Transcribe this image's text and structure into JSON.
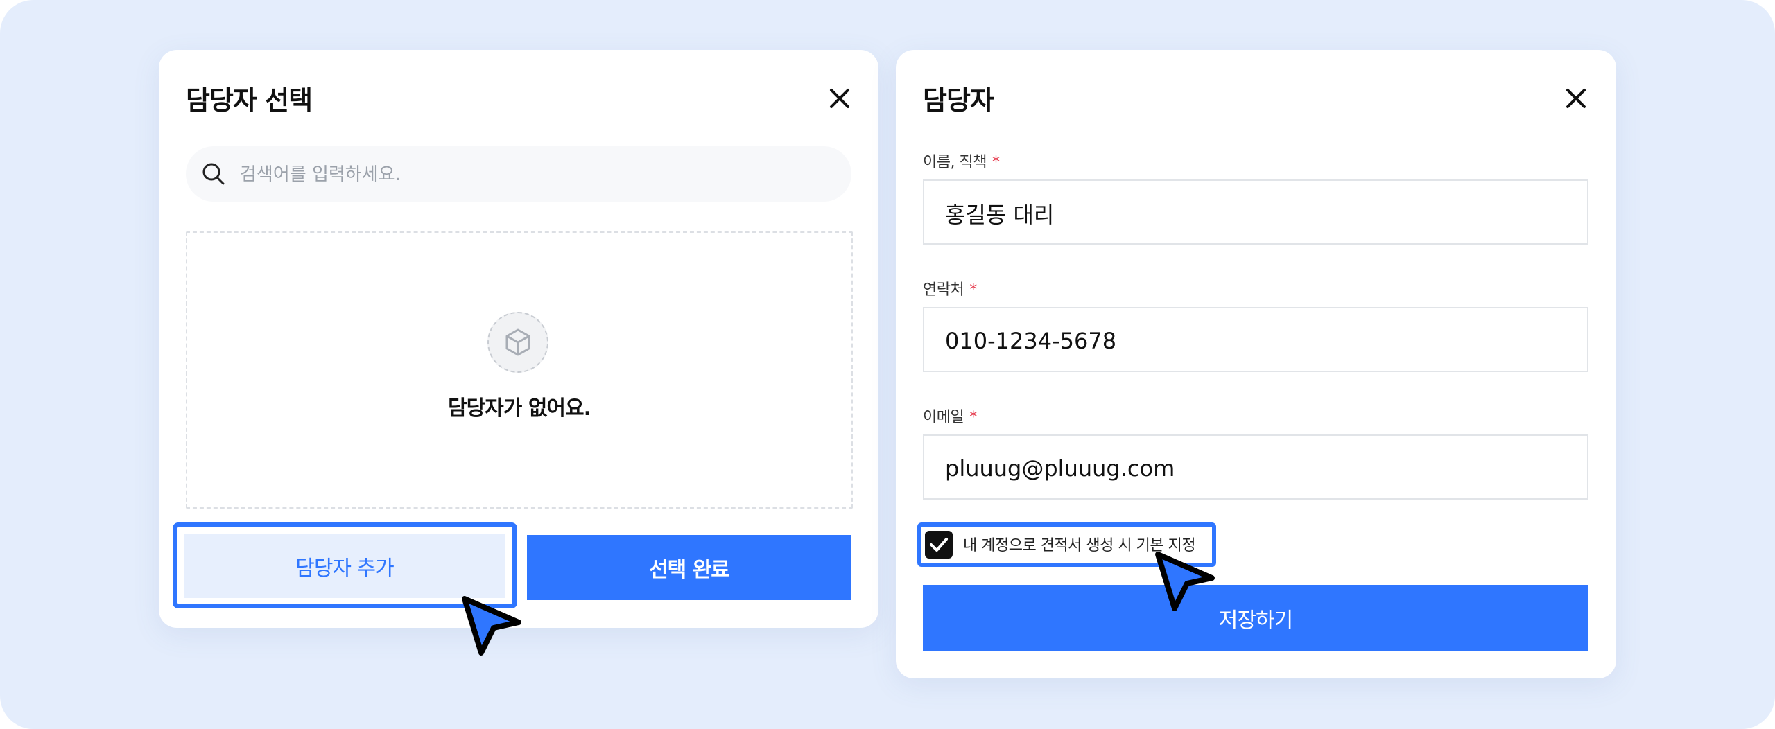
{
  "left_dialog": {
    "title": "담당자 선택",
    "close_icon": "close-icon",
    "search": {
      "placeholder": "검색어를 입력하세요.",
      "value": "",
      "icon": "search-icon"
    },
    "empty_state": {
      "icon": "box-icon",
      "message": "담당자가 없어요."
    },
    "add_button_label": "담당자 추가",
    "done_button_label": "선택 완료"
  },
  "right_dialog": {
    "title": "담당자",
    "close_icon": "close-icon",
    "fields": [
      {
        "label": "이름, 직책",
        "required_mark": "*",
        "value": "홍길동 대리"
      },
      {
        "label": "연락처",
        "required_mark": "*",
        "value": "010-1234-5678"
      },
      {
        "label": "이메일",
        "required_mark": "*",
        "value": "pluuug@pluuug.com"
      }
    ],
    "default_checkbox": {
      "checked": true,
      "label": "내 계정으로 견적서 생성 시 기본 지정"
    },
    "save_button_label": "저장하기"
  },
  "colors": {
    "background": "#e4edfc",
    "accent": "#2f76ff",
    "accent_light": "#e7effd",
    "required": "#e5384b"
  }
}
